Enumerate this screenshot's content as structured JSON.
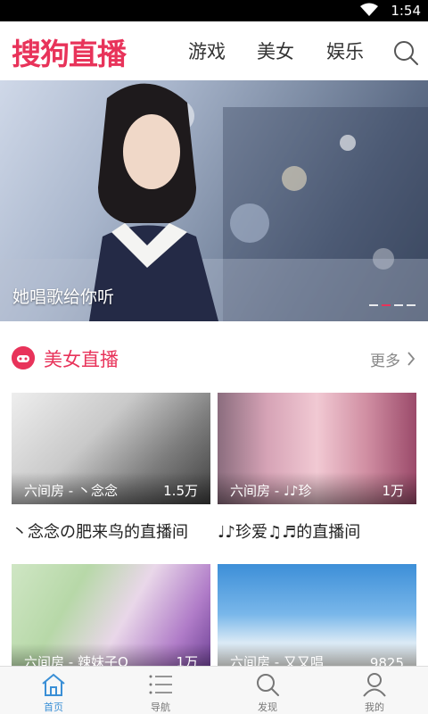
{
  "status_bar": {
    "time": "1:54",
    "icons": [
      "wifi-icon"
    ]
  },
  "header": {
    "logo_text": "搜狗直播",
    "tabs": [
      {
        "label": "游戏"
      },
      {
        "label": "美女"
      },
      {
        "label": "娱乐"
      }
    ],
    "search_icon": "search-icon"
  },
  "banner": {
    "caption": "她唱歌给你听",
    "dots_total": 4,
    "dots_active_index": 1
  },
  "section": {
    "title": "美女直播",
    "more_label": "更多",
    "icon": "gamepad-icon",
    "accent_color": "#e8335a"
  },
  "cards": [
    {
      "room": "六间房 - 丶念念",
      "count": "1.5万",
      "title": "丶念念の肥来鸟的直播间"
    },
    {
      "room": "六间房 - ♩♪珍",
      "count": "1万",
      "title": "♩♪珍爱♫♬的直播间"
    },
    {
      "room": "六间房 - 辣妹子Q",
      "count": "1万",
      "title": ""
    },
    {
      "room": "六间房 - 又又唱",
      "count": "9825",
      "title": ""
    }
  ],
  "tabbar": {
    "items": [
      {
        "label": "首页",
        "icon": "home-icon",
        "active": true
      },
      {
        "label": "导航",
        "icon": "list-icon",
        "active": false
      },
      {
        "label": "发现",
        "icon": "search-icon",
        "active": false
      },
      {
        "label": "我的",
        "icon": "user-icon",
        "active": false
      }
    ],
    "active_color": "#3a8fd6"
  }
}
